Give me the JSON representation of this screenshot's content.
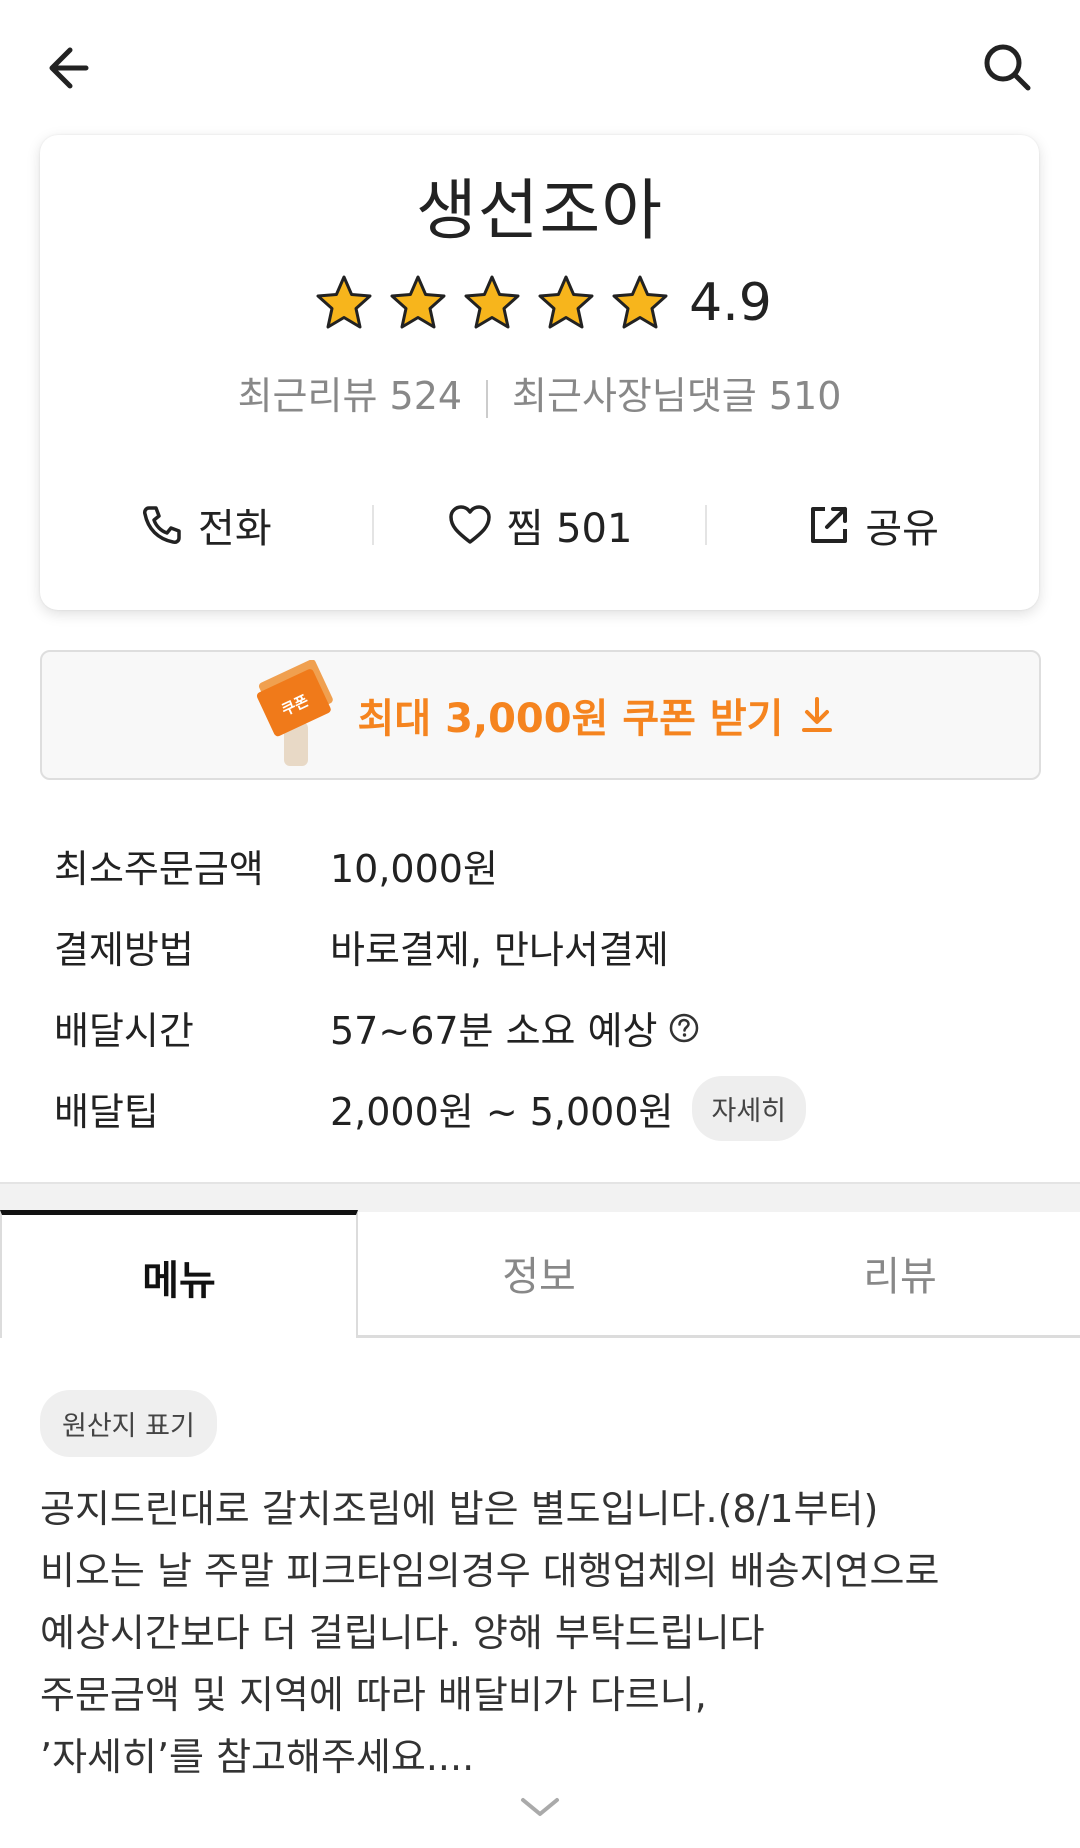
{
  "store": {
    "name": "생선조아",
    "rating": "4.9",
    "stars": 5,
    "recent_reviews": "최근리뷰 524",
    "owner_replies": "최근사장님댓글 510"
  },
  "actions": {
    "call": "전화",
    "like": "찜 501",
    "share": "공유"
  },
  "coupon": {
    "text": "최대 3,000원 쿠폰 받기",
    "badge": "쿠폰"
  },
  "info": {
    "min_order_label": "최소주문금액",
    "min_order_value": "10,000원",
    "payment_label": "결제방법",
    "payment_value": "바로결제, 만나서결제",
    "delivery_time_label": "배달시간",
    "delivery_time_value": "57~67분 소요 예상",
    "delivery_tip_label": "배달팁",
    "delivery_tip_value": "2,000원 ~ 5,000원",
    "detail_button": "자세히"
  },
  "tabs": {
    "menu": "메뉴",
    "info": "정보",
    "review": "리뷰"
  },
  "origin_chip": "원산지 표기",
  "notice": {
    "line1": "공지드린대로 갈치조림에 밥은 별도입니다.(8/1부터)",
    "line2": "비오는 날 주말 피크타임의경우 대행업체의 배송지연으로",
    "line3": "예상시간보다 더 걸립니다. 양해 부탁드립니다",
    "line4": "주문금액 및 지역에 따라 배달비가 다르니,",
    "line5": "’자세히’를 참고해주세요...."
  },
  "colors": {
    "accent": "#f5841f",
    "star": "#f7b51c"
  }
}
